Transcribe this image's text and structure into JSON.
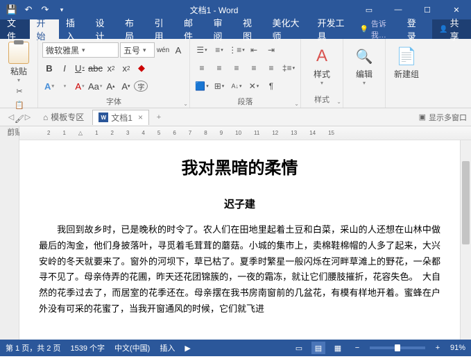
{
  "titlebar": {
    "title": "文档1 - Word"
  },
  "qat": {
    "save": "保存",
    "undo": "撤销",
    "redo": "重做"
  },
  "tabs": {
    "file": "文件",
    "home": "开始",
    "insert": "插入",
    "design": "设计",
    "layout": "布局",
    "references": "引用",
    "mailings": "邮件",
    "review": "审阅",
    "view": "视图",
    "beautify": "美化大师",
    "developer": "开发工具",
    "tell": "告诉我…",
    "login": "登录",
    "share": "共享"
  },
  "ribbon": {
    "clipboard": {
      "label": "剪贴板",
      "paste": "粘贴"
    },
    "font": {
      "label": "字体",
      "name": "微软雅黑",
      "size": "五号",
      "wen": "wén"
    },
    "paragraph": {
      "label": "段落"
    },
    "styles": {
      "label": "样式",
      "btn": "样式"
    },
    "editing": {
      "label": "",
      "edit_btn": "编辑"
    },
    "newgroup": {
      "btn": "新建组"
    }
  },
  "doctabs": {
    "template": "模板专区",
    "doc1": "文档1",
    "showmulti": "显示多窗口"
  },
  "ruler_marks": [
    "2",
    "1",
    "△",
    "1",
    "2",
    "3",
    "4",
    "5",
    "6",
    "7",
    "8",
    "9",
    "10",
    "11",
    "12",
    "13",
    "14",
    "15"
  ],
  "document": {
    "title": "我对黑暗的柔情",
    "author": "迟子建",
    "body": "我回到故乡时，已是晚秋的时令了。农人们在田地里起着土豆和白菜，采山的人还想在山林中做最后的淘金，他们身披落叶，寻觅着毛茸茸的蘑菇。小城的集市上，卖棉鞋棉帽的人多了起来，大兴安岭的冬天就要来了。窗外的河坝下，草已枯了。夏季时繁星一般闪烁在河畔草滩上的野花，一朵都寻不见了。母亲侍弄的花圃，昨天还花团锦簇的，一夜的霜冻，就让它们腰肢摧折，花容失色。　大自然的花季过去了，而居室的花季还在。母亲摆在我书房南窗前的几盆花，有模有样地开着。蜜蜂在户外没有可采的花蜜了，当我开窗通风的时候，它们就飞进"
  },
  "status": {
    "page": "第 1 页，共 2 页",
    "words": "1539 个字",
    "lang": "中文(中国)",
    "insert": "插入",
    "zoom": "91%"
  }
}
